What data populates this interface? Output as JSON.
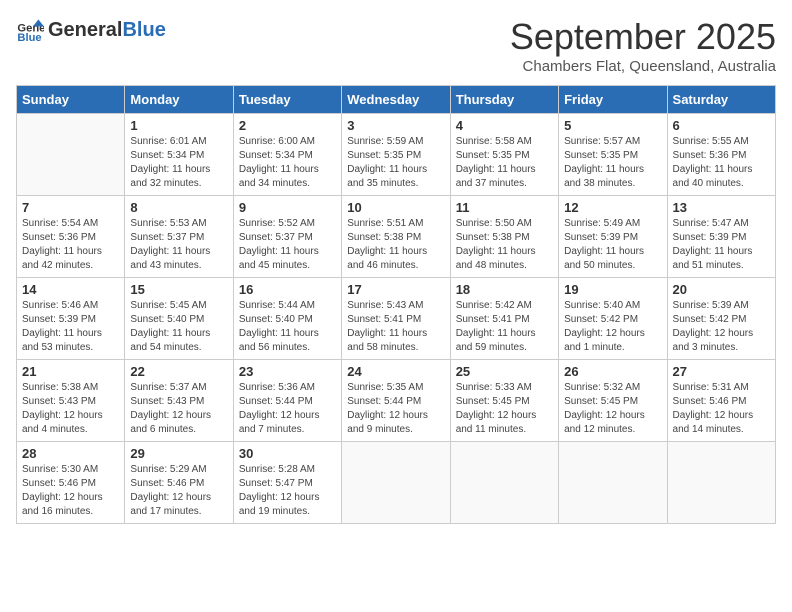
{
  "header": {
    "logo_general": "General",
    "logo_blue": "Blue",
    "title": "September 2025",
    "subtitle": "Chambers Flat, Queensland, Australia"
  },
  "days_of_week": [
    "Sunday",
    "Monday",
    "Tuesday",
    "Wednesday",
    "Thursday",
    "Friday",
    "Saturday"
  ],
  "weeks": [
    [
      {
        "day": "",
        "info": ""
      },
      {
        "day": "1",
        "info": "Sunrise: 6:01 AM\nSunset: 5:34 PM\nDaylight: 11 hours\nand 32 minutes."
      },
      {
        "day": "2",
        "info": "Sunrise: 6:00 AM\nSunset: 5:34 PM\nDaylight: 11 hours\nand 34 minutes."
      },
      {
        "day": "3",
        "info": "Sunrise: 5:59 AM\nSunset: 5:35 PM\nDaylight: 11 hours\nand 35 minutes."
      },
      {
        "day": "4",
        "info": "Sunrise: 5:58 AM\nSunset: 5:35 PM\nDaylight: 11 hours\nand 37 minutes."
      },
      {
        "day": "5",
        "info": "Sunrise: 5:57 AM\nSunset: 5:35 PM\nDaylight: 11 hours\nand 38 minutes."
      },
      {
        "day": "6",
        "info": "Sunrise: 5:55 AM\nSunset: 5:36 PM\nDaylight: 11 hours\nand 40 minutes."
      }
    ],
    [
      {
        "day": "7",
        "info": "Sunrise: 5:54 AM\nSunset: 5:36 PM\nDaylight: 11 hours\nand 42 minutes."
      },
      {
        "day": "8",
        "info": "Sunrise: 5:53 AM\nSunset: 5:37 PM\nDaylight: 11 hours\nand 43 minutes."
      },
      {
        "day": "9",
        "info": "Sunrise: 5:52 AM\nSunset: 5:37 PM\nDaylight: 11 hours\nand 45 minutes."
      },
      {
        "day": "10",
        "info": "Sunrise: 5:51 AM\nSunset: 5:38 PM\nDaylight: 11 hours\nand 46 minutes."
      },
      {
        "day": "11",
        "info": "Sunrise: 5:50 AM\nSunset: 5:38 PM\nDaylight: 11 hours\nand 48 minutes."
      },
      {
        "day": "12",
        "info": "Sunrise: 5:49 AM\nSunset: 5:39 PM\nDaylight: 11 hours\nand 50 minutes."
      },
      {
        "day": "13",
        "info": "Sunrise: 5:47 AM\nSunset: 5:39 PM\nDaylight: 11 hours\nand 51 minutes."
      }
    ],
    [
      {
        "day": "14",
        "info": "Sunrise: 5:46 AM\nSunset: 5:39 PM\nDaylight: 11 hours\nand 53 minutes."
      },
      {
        "day": "15",
        "info": "Sunrise: 5:45 AM\nSunset: 5:40 PM\nDaylight: 11 hours\nand 54 minutes."
      },
      {
        "day": "16",
        "info": "Sunrise: 5:44 AM\nSunset: 5:40 PM\nDaylight: 11 hours\nand 56 minutes."
      },
      {
        "day": "17",
        "info": "Sunrise: 5:43 AM\nSunset: 5:41 PM\nDaylight: 11 hours\nand 58 minutes."
      },
      {
        "day": "18",
        "info": "Sunrise: 5:42 AM\nSunset: 5:41 PM\nDaylight: 11 hours\nand 59 minutes."
      },
      {
        "day": "19",
        "info": "Sunrise: 5:40 AM\nSunset: 5:42 PM\nDaylight: 12 hours\nand 1 minute."
      },
      {
        "day": "20",
        "info": "Sunrise: 5:39 AM\nSunset: 5:42 PM\nDaylight: 12 hours\nand 3 minutes."
      }
    ],
    [
      {
        "day": "21",
        "info": "Sunrise: 5:38 AM\nSunset: 5:43 PM\nDaylight: 12 hours\nand 4 minutes."
      },
      {
        "day": "22",
        "info": "Sunrise: 5:37 AM\nSunset: 5:43 PM\nDaylight: 12 hours\nand 6 minutes."
      },
      {
        "day": "23",
        "info": "Sunrise: 5:36 AM\nSunset: 5:44 PM\nDaylight: 12 hours\nand 7 minutes."
      },
      {
        "day": "24",
        "info": "Sunrise: 5:35 AM\nSunset: 5:44 PM\nDaylight: 12 hours\nand 9 minutes."
      },
      {
        "day": "25",
        "info": "Sunrise: 5:33 AM\nSunset: 5:45 PM\nDaylight: 12 hours\nand 11 minutes."
      },
      {
        "day": "26",
        "info": "Sunrise: 5:32 AM\nSunset: 5:45 PM\nDaylight: 12 hours\nand 12 minutes."
      },
      {
        "day": "27",
        "info": "Sunrise: 5:31 AM\nSunset: 5:46 PM\nDaylight: 12 hours\nand 14 minutes."
      }
    ],
    [
      {
        "day": "28",
        "info": "Sunrise: 5:30 AM\nSunset: 5:46 PM\nDaylight: 12 hours\nand 16 minutes."
      },
      {
        "day": "29",
        "info": "Sunrise: 5:29 AM\nSunset: 5:46 PM\nDaylight: 12 hours\nand 17 minutes."
      },
      {
        "day": "30",
        "info": "Sunrise: 5:28 AM\nSunset: 5:47 PM\nDaylight: 12 hours\nand 19 minutes."
      },
      {
        "day": "",
        "info": ""
      },
      {
        "day": "",
        "info": ""
      },
      {
        "day": "",
        "info": ""
      },
      {
        "day": "",
        "info": ""
      }
    ]
  ]
}
